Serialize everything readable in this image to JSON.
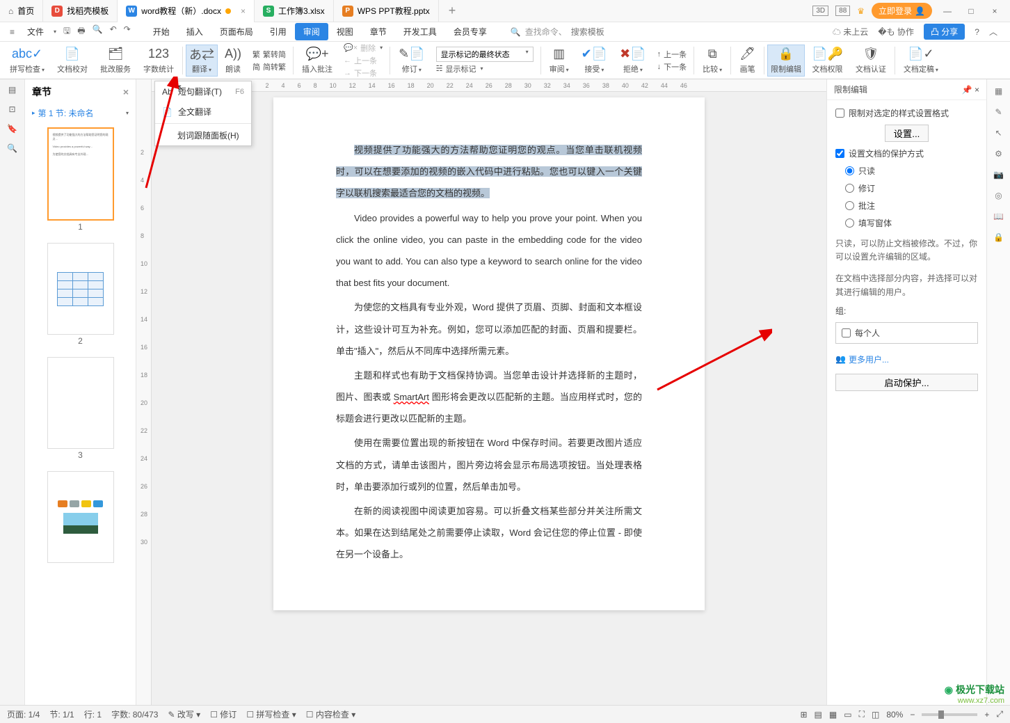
{
  "titlebar": {
    "home": "首页",
    "tabs": [
      {
        "icon": "red",
        "label": "找稻壳模板"
      },
      {
        "icon": "blue",
        "glyph": "W",
        "label": "word教程（新）.docx",
        "active": true,
        "dot": true
      },
      {
        "icon": "green",
        "glyph": "S",
        "label": "工作簿3.xlsx"
      },
      {
        "icon": "orange",
        "glyph": "P",
        "label": "WPS PPT教程.pptx"
      }
    ],
    "boxed1": "3D",
    "boxed2": "88",
    "login": "立即登录"
  },
  "menubar": {
    "file": "文件",
    "tabs": [
      "开始",
      "插入",
      "页面布局",
      "引用",
      "审阅",
      "视图",
      "章节",
      "开发工具",
      "会员专享"
    ],
    "active_index": 4,
    "search_prefix": "查找命令、",
    "search_placeholder": "搜索模板",
    "cloud": "未上云",
    "coop": "协作",
    "share": "分享"
  },
  "ribbon": {
    "spellcheck": "拼写检查",
    "doc_proof": "文档校对",
    "batch": "批改服务",
    "wordcount": "字数统计",
    "translate": "翻译",
    "read_aloud": "朗读",
    "simp_trad": "繁转简",
    "trad_simp": "简转繁",
    "simp_char": "简",
    "trad_char": "繁",
    "insert_comment": "插入批注",
    "delete": "删除",
    "prev_comment": "上一条",
    "next_comment": "下一条",
    "track": "修订",
    "track_state": "显示标记的最终状态",
    "show_markup": "显示标记",
    "review_pane": "审阅",
    "accept": "接受",
    "reject": "拒绝",
    "prev_change": "上一条",
    "next_change": "下一条",
    "compare": "比较",
    "brush": "画笔",
    "restrict": "限制编辑",
    "doc_perm": "文档权限",
    "doc_auth": "文档认证",
    "doc_final": "文档定稿"
  },
  "dropdown": {
    "item1": "短句翻译(T)",
    "item1_key": "F6",
    "item2": "全文翻译",
    "item3": "划词跟随面板(H)"
  },
  "chapters": {
    "title": "章节",
    "section": "第 1 节: 未命名",
    "pages": [
      "1",
      "2",
      "3"
    ]
  },
  "document": {
    "p1": "视频提供了功能强大的方法帮助您证明您的观点。当您单击联机视频时，可以在想要添加的视频的嵌入代码中进行粘贴。您也可以键入一个关键字以联机搜索最适合您的文档的视频。",
    "p2": "Video provides a powerful way to help you prove your point. When you click the online video, you can paste in the embedding code for the video you want to add. You can also type a keyword to search online for the video that best fits your document.",
    "p3a": "为使您的文档具有专业外观，Word 提供了页眉、页脚、封面和文本框设计，这些设计可互为补充。例如，您可以添加匹配的封面、页眉和提要栏。单击\"插入\"，然后从不同库中选择所需元素。",
    "p4a": "主题和样式也有助于文档保持协调。当您单击设计并选择新的主题时，图片、图表或 ",
    "smartart": "SmartArt",
    "p4b": " 图形将会更改以匹配新的主题。当应用样式时，您的标题会进行更改以匹配新的主题。",
    "p5": "使用在需要位置出现的新按钮在 Word 中保存时间。若要更改图片适应文档的方式，请单击该图片，图片旁边将会显示布局选项按钮。当处理表格时，单击要添加行或列的位置，然后单击加号。",
    "p6": "在新的阅读视图中阅读更加容易。可以折叠文档某些部分并关注所需文本。如果在达到结尾处之前需要停止读取，Word 会记住您的停止位置 - 即使在另一个设备上。"
  },
  "right_panel": {
    "title": "限制编辑",
    "restrict_style": "限制对选定的样式设置格式",
    "settings_btn": "设置...",
    "protect_method": "设置文档的保护方式",
    "radios": [
      "只读",
      "修订",
      "批注",
      "填写窗体"
    ],
    "radio_selected": 0,
    "info1": "只读，可以防止文档被修改。不过，你可以设置允许编辑的区域。",
    "info2": "在文档中选择部分内容，并选择可以对其进行编辑的用户。",
    "group_label": "组:",
    "everyone": "每个人",
    "more_users": "更多用户...",
    "start_protect": "启动保护..."
  },
  "status": {
    "page": "页面: 1/4",
    "section": "节: 1/1",
    "row": "行: 1",
    "chars": "字数: 80/473",
    "rework": "改写",
    "track": "修订",
    "spell": "拼写检查",
    "content": "内容检查",
    "zoom": "80%"
  },
  "ruler": {
    "hticks": [
      "2",
      "2",
      "4",
      "6",
      "8",
      "10",
      "12",
      "14",
      "16",
      "18",
      "20",
      "22",
      "24",
      "26",
      "28",
      "30",
      "32",
      "34",
      "36",
      "38",
      "40",
      "42",
      "44",
      "46"
    ]
  },
  "watermark": {
    "name": "极光下载站",
    "url": "www.xz7.com"
  }
}
